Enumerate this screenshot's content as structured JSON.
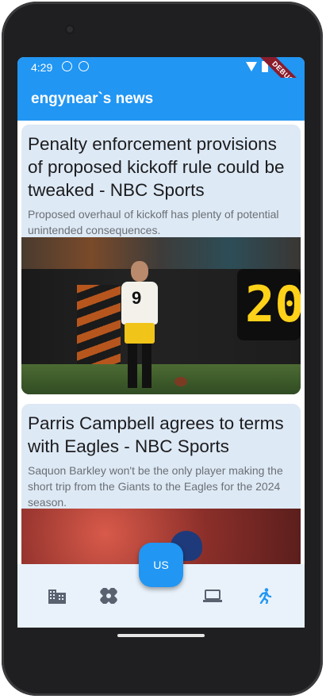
{
  "status_bar": {
    "time": "4:29"
  },
  "debug_banner": "DEBUG",
  "app_bar": {
    "title": "engynear`s news"
  },
  "articles": [
    {
      "title": "Penalty enforcement provisions of proposed kickoff rule could be tweaked - NBC Sports",
      "description": "Proposed overhaul of kickoff has plenty of potential unintended consequences.",
      "image_text": "20",
      "jersey_number": "9"
    },
    {
      "title": "Parris Campbell agrees to terms with Eagles - NBC Sports",
      "description": "Saquon Barkley won't be the only player making the short trip from the Giants to the Eagles for the 2024 season."
    }
  ],
  "bottom_nav": {
    "items": [
      {
        "icon": "business-building-icon"
      },
      {
        "icon": "health-bandage-icon"
      },
      {
        "icon": "technology-laptop-icon"
      },
      {
        "icon": "sports-run-icon"
      }
    ],
    "center_button_label": "US"
  },
  "colors": {
    "primary": "#2196f3",
    "card_bg": "#dde9f5",
    "nav_bg": "#e9f2fb",
    "debug": "#8b1c2c"
  }
}
